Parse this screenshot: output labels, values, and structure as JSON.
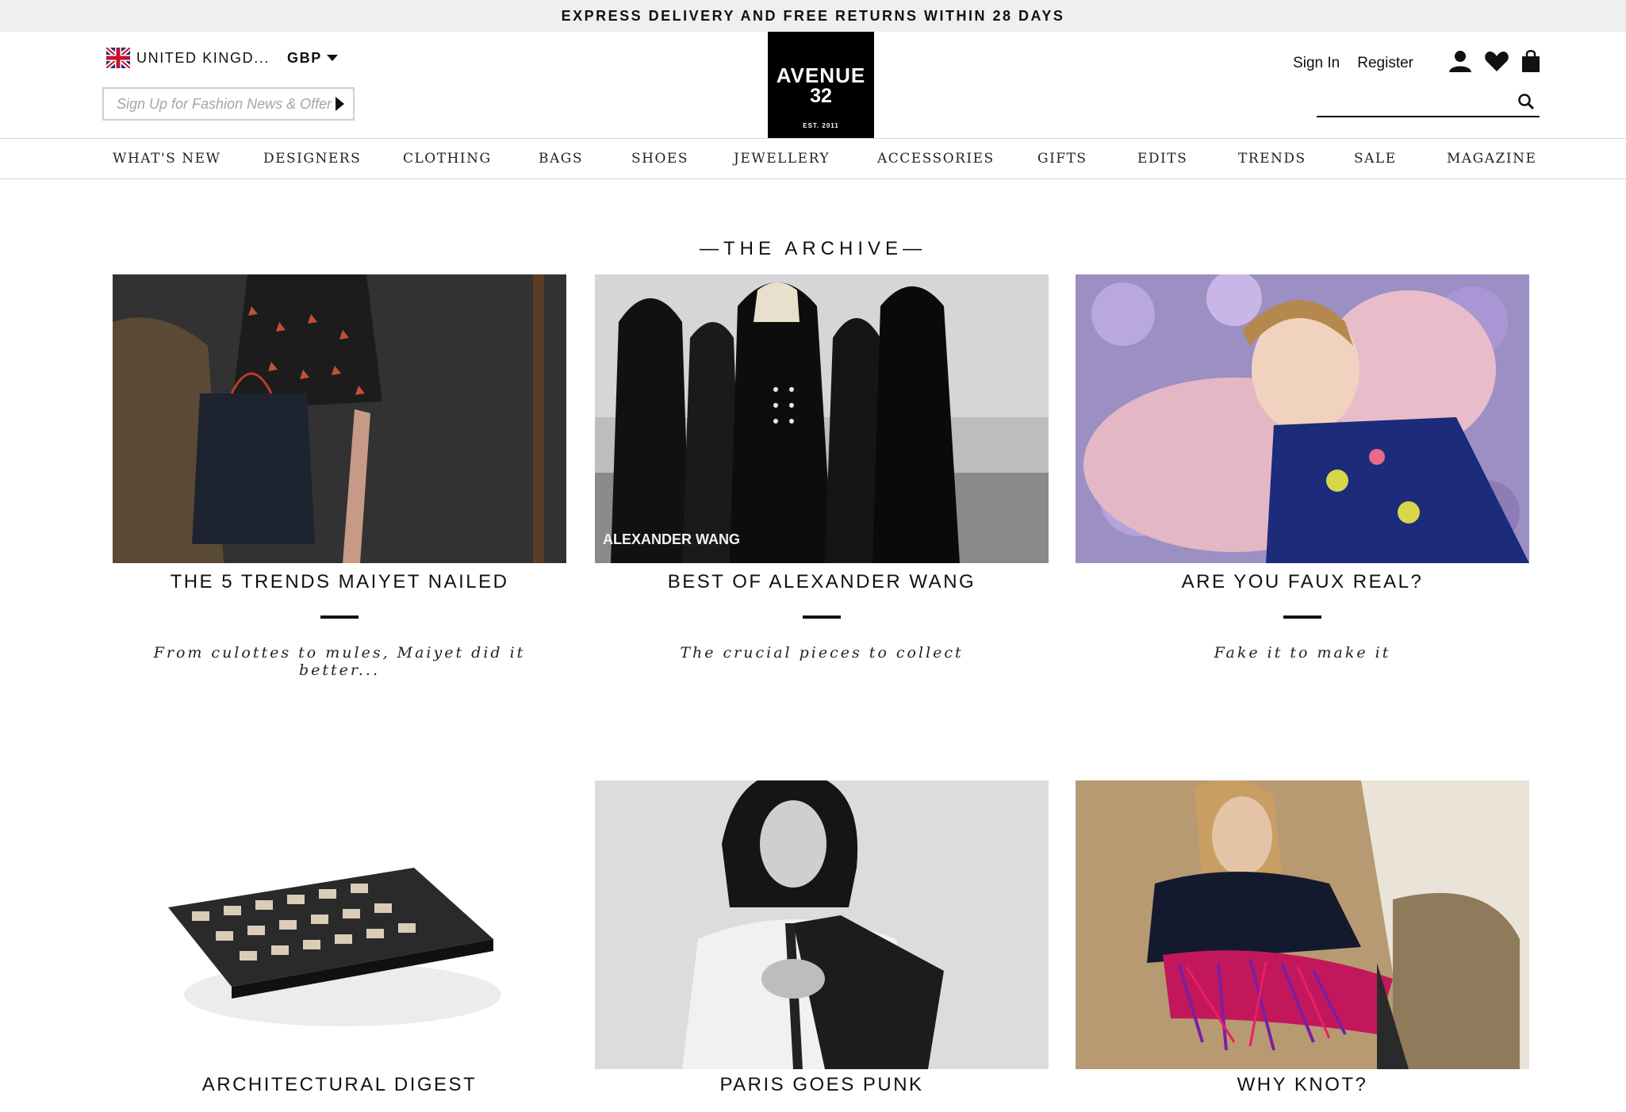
{
  "promo": "EXPRESS DELIVERY AND FREE RETURNS WITHIN 28 DAYS",
  "locale": {
    "country": "UNITED KINGD...",
    "currency": "GBP"
  },
  "newsletter": {
    "placeholder": "Sign Up for Fashion News & Offers"
  },
  "logo": {
    "line1": "AVENUE",
    "line2": "32",
    "line3": "EST. 2011"
  },
  "account": {
    "sign_in": "Sign In",
    "register": "Register"
  },
  "nav": [
    "WHAT'S NEW",
    "DESIGNERS",
    "CLOTHING",
    "BAGS",
    "SHOES",
    "JEWELLERY",
    "ACCESSORIES",
    "GIFTS",
    "EDITS",
    "TRENDS",
    "SALE",
    "MAGAZINE"
  ],
  "archive": {
    "title": "THE ARCHIVE",
    "cards": [
      {
        "title": "THE 5 TRENDS MAIYET NAILED",
        "subtitle": "From culottes to mules, Maiyet did it better..."
      },
      {
        "title": "BEST OF ALEXANDER WANG",
        "subtitle": "The crucial pieces to collect",
        "image_text": "ALEXANDER WANG"
      },
      {
        "title": "ARE YOU FAUX REAL?",
        "subtitle": "Fake it to make it"
      },
      {
        "title": "ARCHITECTURAL DIGEST",
        "subtitle": ""
      },
      {
        "title": "PARIS GOES PUNK",
        "subtitle": ""
      },
      {
        "title": "WHY KNOT?",
        "subtitle": ""
      }
    ]
  },
  "colors": {
    "promo_bg": "#efefef",
    "logo_bg": "#000000",
    "text": "#111111"
  }
}
